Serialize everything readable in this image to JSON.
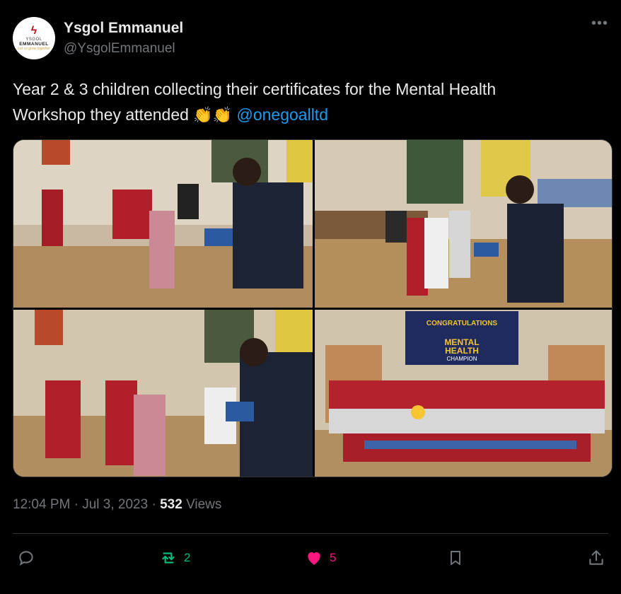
{
  "account": {
    "avatar_text": [
      "YSGOL",
      "EMMANUEL",
      "Let us grow together"
    ],
    "display_name": "Ysgol Emmanuel",
    "handle": "@YsgolEmmanuel"
  },
  "tweet": {
    "text_line1": "Year 2 & 3 children collecting their certificates for the Mental Health",
    "text_line2_prefix": "Workshop they attended",
    "emoji": "👏👏",
    "mention": "@onegoalltd"
  },
  "media": {
    "count": 4,
    "screen_text": [
      "CONGRATULATIONS",
      "MENTAL",
      "HEALTH",
      "CHAMPION"
    ]
  },
  "meta": {
    "time": "12:04 PM",
    "separator": "·",
    "date": "Jul 3, 2023",
    "views_count": "532",
    "views_label": "Views"
  },
  "actions": {
    "reply_count": "",
    "retweet_count": "2",
    "like_count": "5"
  },
  "colors": {
    "accent_blue": "#1d9bf0",
    "retweet_green": "#00ba7c",
    "like_pink": "#f91880",
    "muted": "#71767b"
  }
}
